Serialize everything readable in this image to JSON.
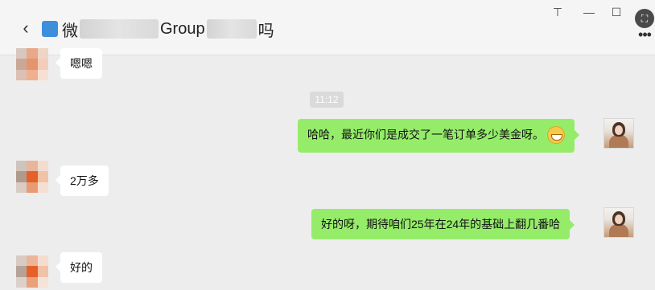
{
  "header": {
    "back_glyph": "‹",
    "title_fragment_1": "微",
    "title_fragment_2": "Group",
    "title_fragment_3": "吗",
    "icons": {
      "back": "chevron-left-icon",
      "group": "group-chat-icon",
      "pin": "pin-icon",
      "minimize": "minimize-icon",
      "maximize": "maximize-icon",
      "screenshot": "screenshot-tool-icon",
      "more": "more-options-icon"
    },
    "pin_glyph": "⊤",
    "minimize_glyph": "—",
    "maximize_glyph": "☐",
    "more_glyph": "•••",
    "screenshot_glyph": "⛶"
  },
  "messages": [
    {
      "side": "in",
      "text": "嗯嗯"
    },
    {
      "side": "time",
      "text": "11:12"
    },
    {
      "side": "out",
      "text": "哈哈，最近你们是成交了一笔订单多少美金呀。",
      "emoji": "grinning-emoji"
    },
    {
      "side": "in",
      "text": "2万多"
    },
    {
      "side": "out",
      "text": "好的呀，期待咱们25年在24年的基础上翻几番哈"
    },
    {
      "side": "in",
      "text": "好的"
    }
  ],
  "colors": {
    "background": "#ededed",
    "outgoing_bubble": "#95ec69",
    "incoming_bubble": "#ffffff",
    "timestamp_bg": "#dadada"
  }
}
